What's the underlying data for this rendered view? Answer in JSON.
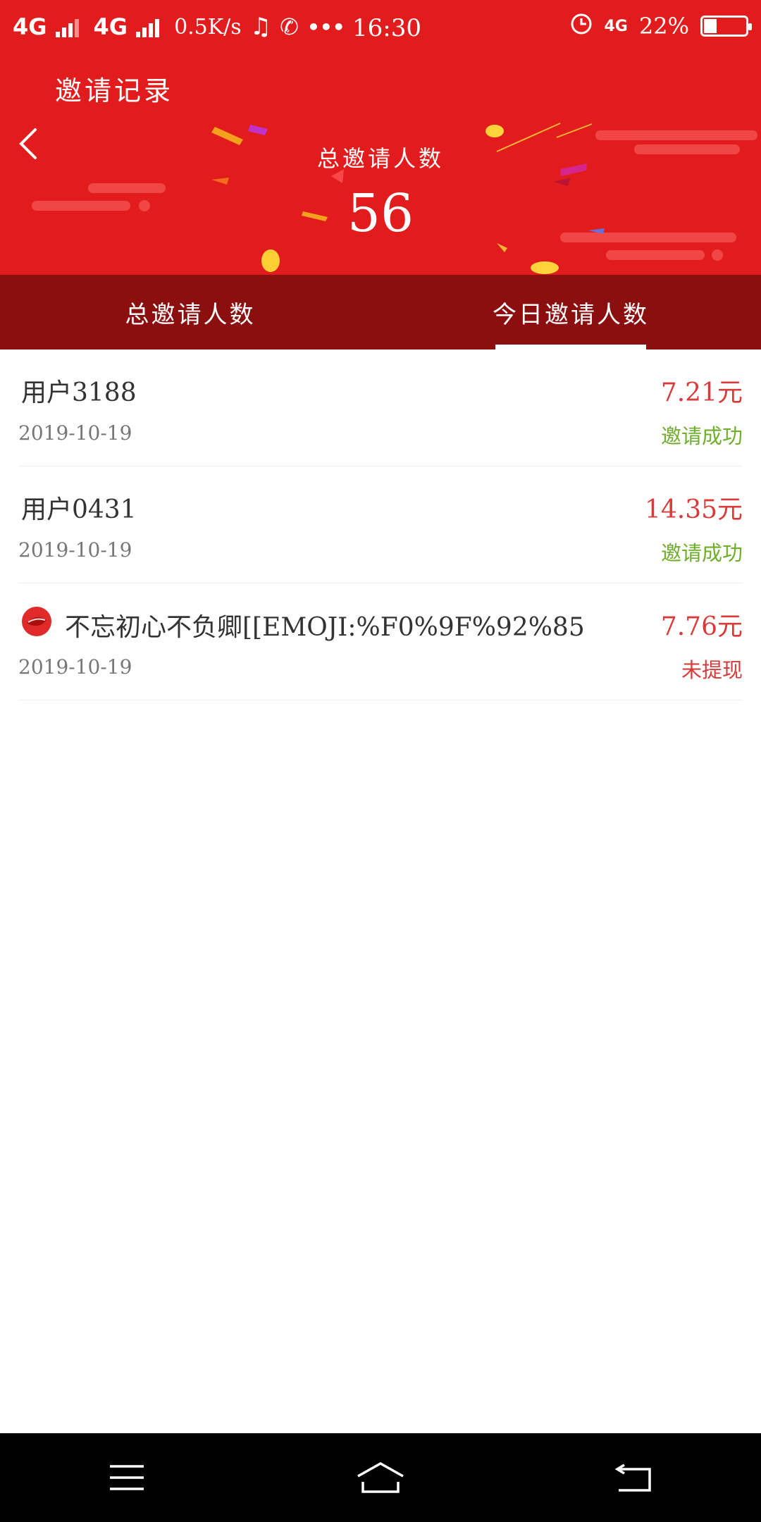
{
  "status_bar": {
    "network1": "4G",
    "network2": "4G",
    "speed": "0.5K/s",
    "time": "16:30",
    "network3": "4G",
    "battery": "22%"
  },
  "header": {
    "title": "邀请记录",
    "total_label": "总邀请人数",
    "total_value": "56"
  },
  "tabs": [
    {
      "label": "总邀请人数",
      "active": false
    },
    {
      "label": "今日邀请人数",
      "active": true
    }
  ],
  "records": [
    {
      "name": "用户3188",
      "date": "2019-10-19",
      "amount": "7.21元",
      "status": "邀请成功",
      "status_color": "#6fae2e",
      "icon": ""
    },
    {
      "name": "用户0431",
      "date": "2019-10-19",
      "amount": "14.35元",
      "status": "邀请成功",
      "status_color": "#6fae2e",
      "icon": ""
    },
    {
      "name": "不忘初心不负卿[[EMOJI:%F0%9F%92%85",
      "date": "2019-10-19",
      "amount": "7.76元",
      "status": "未提现",
      "status_color": "#d93b3b",
      "icon": "lips-icon"
    }
  ],
  "colors": {
    "header_red": "#e21c1c",
    "tab_bar_dark_red": "#8c0f0f",
    "amount_red": "#d93b3b",
    "success_green": "#6fae2e"
  }
}
